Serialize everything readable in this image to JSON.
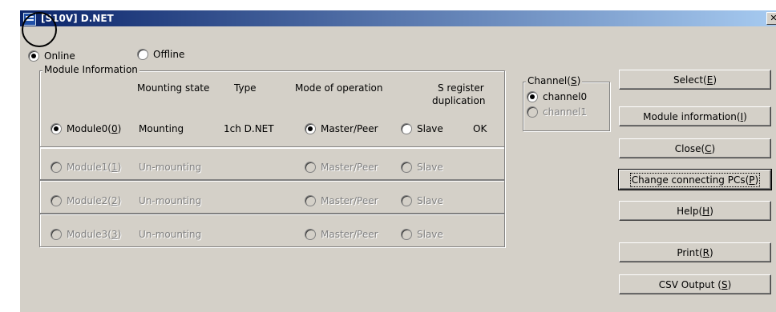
{
  "caption": "",
  "window": {
    "title": "[S10V] D.NET",
    "close_glyph": "✕"
  },
  "connection": {
    "online_label": "Online",
    "offline_label": "Offline",
    "selected": "online"
  },
  "module_info": {
    "group_label": "Module Information",
    "headers": {
      "mounting_state": "Mounting state",
      "type": "Type",
      "mode": "Mode of operation",
      "s_register_line1": "S register",
      "s_register_line2": "duplication"
    },
    "rows": [
      {
        "label": "Module0",
        "mnemonic": "0",
        "state": "Mounting",
        "type": "1ch D.NET",
        "master_label": "Master/Peer",
        "slave_label": "Slave",
        "dup": "OK",
        "enabled": true,
        "module_selected": true,
        "mode_selected": "master"
      },
      {
        "label": "Module1",
        "mnemonic": "1",
        "state": "Un-mounting",
        "type": "",
        "master_label": "Master/Peer",
        "slave_label": "Slave",
        "dup": "",
        "enabled": false,
        "module_selected": false,
        "mode_selected": ""
      },
      {
        "label": "Module2",
        "mnemonic": "2",
        "state": "Un-mounting",
        "type": "",
        "master_label": "Master/Peer",
        "slave_label": "Slave",
        "dup": "",
        "enabled": false,
        "module_selected": false,
        "mode_selected": ""
      },
      {
        "label": "Module3",
        "mnemonic": "3",
        "state": "Un-mounting",
        "type": "",
        "master_label": "Master/Peer",
        "slave_label": "Slave",
        "dup": "",
        "enabled": false,
        "module_selected": false,
        "mode_selected": ""
      }
    ]
  },
  "channel": {
    "group_label": "Channel",
    "group_mnemonic": "S",
    "channel0_label": "channel0",
    "channel1_label": "channel1",
    "selected": "channel0"
  },
  "buttons": {
    "select": {
      "label": "Select",
      "mnemonic": "E"
    },
    "module_information": {
      "label": "Module information",
      "mnemonic": "I"
    },
    "close": {
      "label": "Close",
      "mnemonic": "C"
    },
    "change_connecting": {
      "label": "Change connecting PCs",
      "mnemonic": "P"
    },
    "help": {
      "label": "Help",
      "mnemonic": "H"
    },
    "print": {
      "label": "Print",
      "mnemonic": "R"
    },
    "csv_output": {
      "label": "CSV Output ",
      "mnemonic": "S"
    }
  }
}
